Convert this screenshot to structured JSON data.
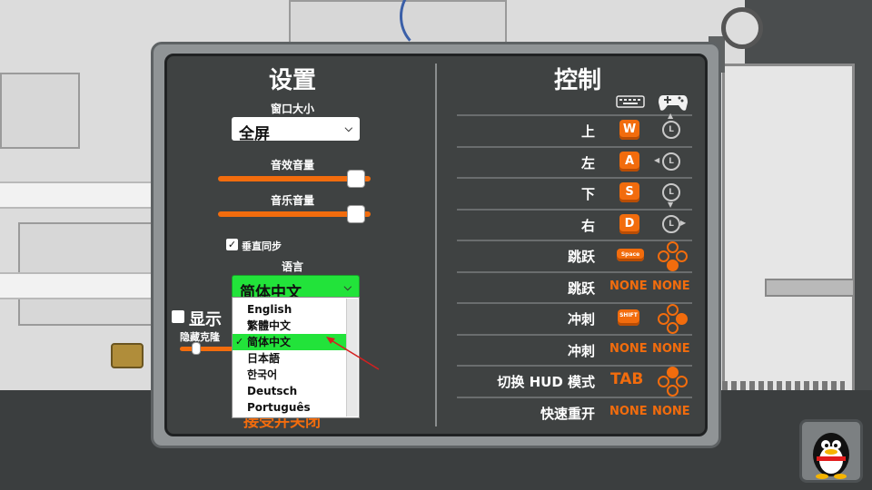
{
  "settings": {
    "title": "设置",
    "window_size_label": "窗口大小",
    "window_size_value": "全屏",
    "sfx_volume_label": "音效音量",
    "sfx_volume_level": 0.95,
    "music_volume_label": "音乐音量",
    "music_volume_level": 0.95,
    "vsync_label": "垂直同步",
    "vsync_checked": true,
    "language_label": "语言",
    "language_value": "简体中文",
    "language_options": [
      "English",
      "繁體中文",
      "简体中文",
      "日本語",
      "한국어",
      "Deutsch",
      "Português"
    ],
    "selected_language_index": 2,
    "show_partial_label": "显示",
    "hide_partial_label": "隐藏克隆",
    "confirm_partial_label": "接受并关闭"
  },
  "controls": {
    "title": "控制",
    "rows": [
      {
        "action": "上",
        "keyboard": "W",
        "gamepad": "stick-up"
      },
      {
        "action": "左",
        "keyboard": "A",
        "gamepad": "stick-left"
      },
      {
        "action": "下",
        "keyboard": "S",
        "gamepad": "stick-down"
      },
      {
        "action": "右",
        "keyboard": "D",
        "gamepad": "stick-right"
      },
      {
        "action": "跳跃",
        "keyboard": "Space",
        "gamepad": "face-buttons-bottom"
      },
      {
        "action": "跳跃",
        "keyboard": "NONE",
        "gamepad": "NONE"
      },
      {
        "action": "冲刺",
        "keyboard": "SHIFT",
        "gamepad": "face-buttons-right"
      },
      {
        "action": "冲刺",
        "keyboard": "NONE",
        "gamepad": "NONE"
      },
      {
        "action": "切换 HUD 模式",
        "keyboard": "TAB",
        "gamepad": "face-buttons-top"
      },
      {
        "action": "快速重开",
        "keyboard": "NONE",
        "gamepad": "NONE"
      }
    ]
  },
  "colors": {
    "accent_orange": "#f26c0d",
    "selection_green": "#22e33a",
    "panel_dark": "#3f4242",
    "panel_frame": "#909496"
  }
}
